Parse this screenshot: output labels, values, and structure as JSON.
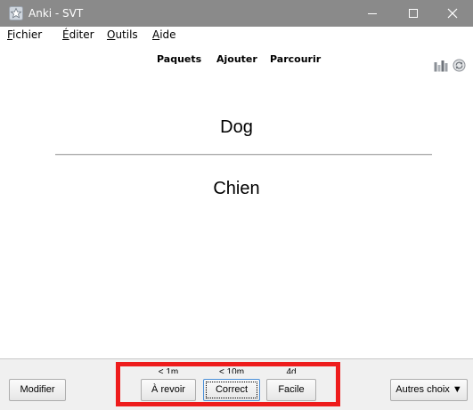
{
  "window": {
    "title": "Anki - SVT",
    "icons": {
      "app": "anki-star-icon",
      "minimize": "minimize-icon",
      "maximize": "maximize-icon",
      "close": "close-icon"
    }
  },
  "menu": {
    "fichier": "Fichier",
    "editer": "Éditer",
    "outils": "Outils",
    "aide": "Aide"
  },
  "toolbar": {
    "paquets": "Paquets",
    "ajouter": "Ajouter",
    "parcourir": "Parcourir",
    "icons": [
      "stats-icon",
      "sync-icon"
    ]
  },
  "card": {
    "front": "Dog",
    "back": "Chien"
  },
  "answer_bar": {
    "modifier": "Modifier",
    "buttons": [
      {
        "label": "À revoir",
        "interval": "< 1m"
      },
      {
        "label": "Correct",
        "interval": "< 10m"
      },
      {
        "label": "Facile",
        "interval": "4d"
      }
    ],
    "more": "Autres choix ▼"
  },
  "colors": {
    "titlebar": "#8a8a8a",
    "highlight": "#ee1c1c",
    "bottombar": "#f0f0f0"
  }
}
